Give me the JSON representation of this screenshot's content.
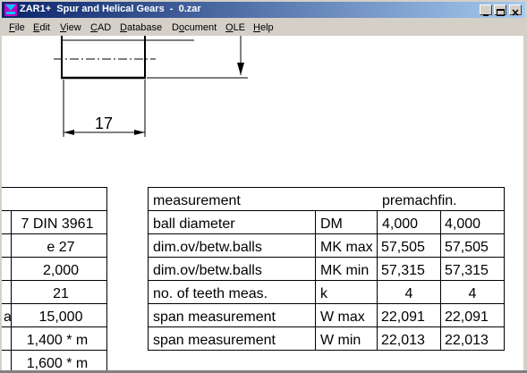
{
  "window": {
    "title": "ZAR1+  Spur and Helical Gears  -  0.zar",
    "controls": [
      "minimize",
      "maximize",
      "close"
    ]
  },
  "menu": {
    "items": [
      {
        "label": "File",
        "key": "F",
        "rest": "ile"
      },
      {
        "label": "Edit",
        "key": "E",
        "rest": "dit"
      },
      {
        "label": "View",
        "key": "V",
        "rest": "iew"
      },
      {
        "label": "CAD",
        "key": "C",
        "rest": "AD"
      },
      {
        "label": "Database",
        "key": "D",
        "rest": "atabase"
      },
      {
        "label": "Document",
        "key": "o",
        "pre": "D",
        "rest": "cument"
      },
      {
        "label": "OLE",
        "key": "O",
        "rest": "LE"
      },
      {
        "label": "Help",
        "key": "H",
        "rest": "elp"
      }
    ]
  },
  "drawing": {
    "dimension": "17"
  },
  "left_table": {
    "cells": [
      "7 DIN 3961",
      "e 27",
      "2,000",
      "21",
      "15,000",
      "1,400 * m",
      "1,600 * m"
    ],
    "cut_prefix": "a"
  },
  "meas_table": {
    "header": {
      "label": "measurement",
      "col": "premachfin."
    },
    "rows": [
      {
        "name": "ball diameter",
        "sym": "DM",
        "v1": "4,000",
        "v2": "4,000"
      },
      {
        "name": "dim.ov/betw.balls",
        "sym": "MK max",
        "v1": "57,505",
        "v2": "57,505"
      },
      {
        "name": "dim.ov/betw.balls",
        "sym": "MK min",
        "v1": "57,315",
        "v2": "57,315"
      },
      {
        "name": "no. of teeth meas.",
        "sym": "k",
        "v1": "4",
        "v2": "4"
      },
      {
        "name": "span measurement",
        "sym": "W max",
        "v1": "22,091",
        "v2": "22,091"
      },
      {
        "name": "span measurement",
        "sym": "W min",
        "v1": "22,013",
        "v2": "22,013"
      }
    ]
  }
}
